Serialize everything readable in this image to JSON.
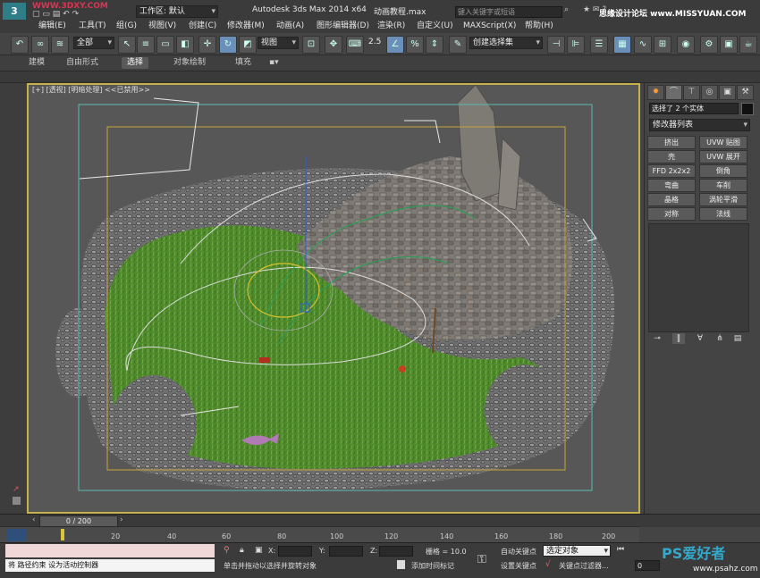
{
  "window": {
    "app_title": "Autodesk 3ds Max  2014 x64",
    "file_name": "动画教程.max",
    "workspace_label": "工作区: 默认",
    "search_placeholder": "键入关键字或短语",
    "watermark_top": "思缘设计论坛 www.MISSYUAN.COM",
    "watermark_top_left": "WWW.3DXY.COM"
  },
  "menu": {
    "items": [
      "编辑(E)",
      "工具(T)",
      "组(G)",
      "视图(V)",
      "创建(C)",
      "修改器(M)",
      "动画(A)",
      "图形编辑器(D)",
      "渲染(R)",
      "自定义(U)",
      "MAXScript(X)",
      "帮助(H)"
    ]
  },
  "toolbar": {
    "selection_filter": "全部",
    "ref_coord": "视图",
    "snap_value": "2.5",
    "named_selection": "创建选择集"
  },
  "ribbon": {
    "tabs": [
      "建模",
      "自由形式",
      "选择",
      "对象绘制",
      "填充"
    ],
    "active_tab": "选择"
  },
  "viewport": {
    "label": "[+] [透视] [明暗处理]  <<已禁用>>"
  },
  "command_panel": {
    "selection_text": "选择了 2 个实体",
    "modifier_list": "修改器列表",
    "modifiers": [
      "挤出",
      "UVW 贴图",
      "壳",
      "UVW 展开",
      "FFD 2x2x2",
      "倒角",
      "弯曲",
      "车削",
      "晶格",
      "涡轮平滑",
      "对称",
      "法线"
    ]
  },
  "timeline": {
    "frame_display": "0 / 200",
    "ticks": [
      "20",
      "40",
      "60",
      "80",
      "100",
      "120",
      "140",
      "160",
      "180",
      "200"
    ]
  },
  "status": {
    "prompt_line": "将 路径约束 设为活动控制器",
    "hint": "单击并拖动以选择并旋转对象",
    "x_label": "X:",
    "y_label": "Y:",
    "z_label": "Z:",
    "grid_label": "栅格 = 10.0",
    "auto_key": "自动关键点",
    "set_key": "设置关键点",
    "selected_object": "选定对象",
    "key_filter": "关键点过滤器...",
    "add_time_tag": "添加时间标记",
    "frame_value": "0",
    "watermark_bottom": "PS爱好者",
    "watermark_bottom_url": "www.psahz.com"
  },
  "colors": {
    "viewport_border": "#c7b14a",
    "grass": "#4f8a2a",
    "stone": "#7c7c7c",
    "active_blue": "#6a8fb8"
  }
}
